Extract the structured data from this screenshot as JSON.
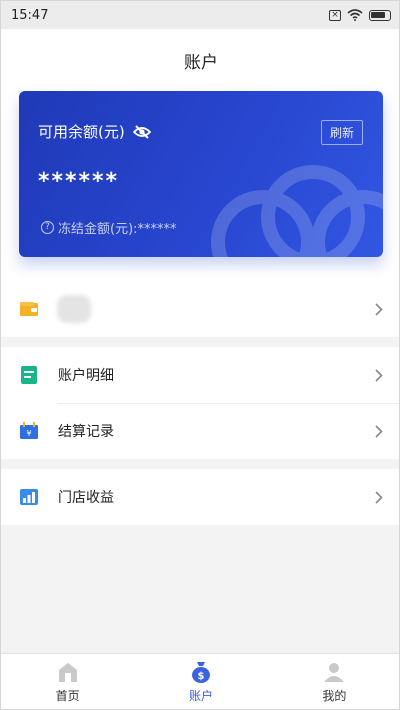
{
  "status_bar": {
    "time": "15:47",
    "icons": [
      "close-box-icon",
      "wifi-icon",
      "battery-icon"
    ]
  },
  "header": {
    "title": "账户"
  },
  "balance_card": {
    "label": "可用余额(元)",
    "visibility_icon": "eye-slash-icon",
    "refresh_label": "刷新",
    "amount": "******",
    "frozen_label": "冻结金额(元):******",
    "help_icon": "question-circle-icon"
  },
  "wallet_row": {
    "icon": "wallet-icon",
    "chevron": "chevron-right-icon"
  },
  "menu_items": [
    {
      "label": "账户明细",
      "icon": "account-detail-icon"
    },
    {
      "label": "结算记录",
      "icon": "settlement-record-icon"
    },
    {
      "label": "门店收益",
      "icon": "store-income-icon"
    }
  ],
  "bottom_nav": [
    {
      "label": "首页",
      "icon": "home-icon",
      "active": false
    },
    {
      "label": "账户",
      "icon": "money-bag-icon",
      "active": true
    },
    {
      "label": "我的",
      "icon": "user-icon",
      "active": false
    }
  ],
  "colors": {
    "accent": "#3a63e0",
    "card_start": "#1f3ab8",
    "card_end": "#3157e3",
    "wallet_icon": "#f5b027",
    "detail_icon": "#18b48a",
    "settle_icon": "#2f6fe0",
    "income_icon": "#3a8be8"
  }
}
